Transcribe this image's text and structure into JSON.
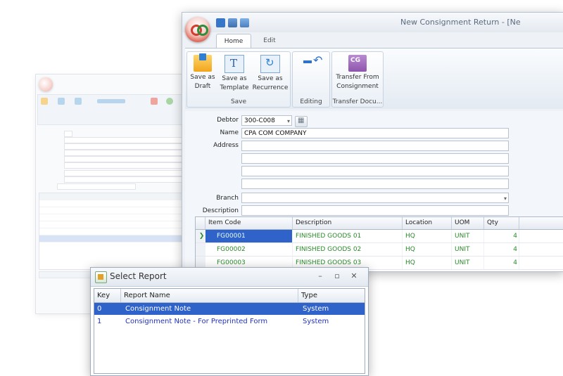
{
  "main_window": {
    "title": "New Consignment Return - [Ne",
    "tabs": [
      "Home",
      "Edit"
    ],
    "ribbon": {
      "save_group": {
        "caption": "Save",
        "buttons": [
          {
            "label_line1": "Save as",
            "label_line2": "Draft",
            "icon": "save-draft-icon"
          },
          {
            "label_line1": "Save as",
            "label_line2": "Template",
            "icon": "template-icon"
          },
          {
            "label_line1": "Save as",
            "label_line2": "Recurrence",
            "icon": "recurrence-icon"
          }
        ]
      },
      "editing_group": {
        "caption": "Editing",
        "icon": "edit-arrow-icon"
      },
      "transfer_group": {
        "caption": "Transfer Docu...",
        "button_line1": "Transfer From",
        "button_line2": "Consignment",
        "icon": "transfer-icon"
      }
    },
    "form": {
      "debtor_label": "Debtor",
      "debtor_value": "300-C008",
      "name_label": "Name",
      "name_value": "CPA COM COMPANY",
      "address_label": "Address",
      "branch_label": "Branch",
      "description_label": "Description"
    },
    "grid": {
      "columns": [
        "Item Code",
        "Description",
        "Location",
        "UOM",
        "Qty"
      ],
      "rows": [
        {
          "item_code": "FG00001",
          "description": "FINISHED GOODS 01",
          "location": "HQ",
          "uom": "UNIT",
          "qty": "4"
        },
        {
          "item_code": "FG00002",
          "description": "FINISHED GOODS 02",
          "location": "HQ",
          "uom": "UNIT",
          "qty": "4"
        },
        {
          "item_code": "FG00003",
          "description": "FINISHED GOODS 03",
          "location": "HQ",
          "uom": "UNIT",
          "qty": "4"
        }
      ]
    }
  },
  "dialog": {
    "title": "Select Report",
    "columns": [
      "Key",
      "Report Name",
      "Type"
    ],
    "rows": [
      {
        "key": "0",
        "name": "Consignment Note",
        "type": "System"
      },
      {
        "key": "1",
        "name": "Consignment Note - For Preprinted Form",
        "type": "System"
      }
    ]
  },
  "colors": {
    "selection": "#2f63c9",
    "item_text": "#2a8a2a",
    "report_link": "#2233bb"
  }
}
